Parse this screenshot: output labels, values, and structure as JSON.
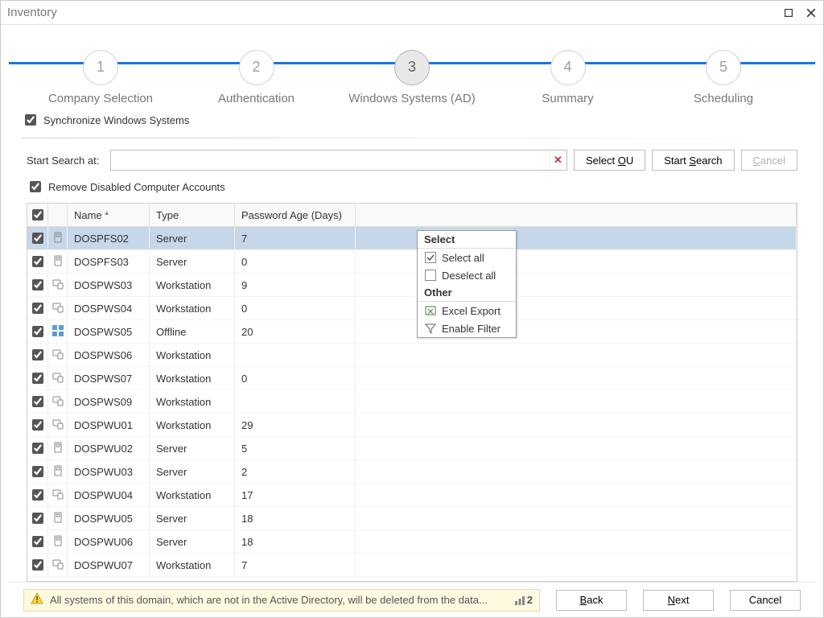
{
  "window": {
    "title": "Inventory"
  },
  "wizard": {
    "steps": [
      {
        "num": "1",
        "label": "Company Selection"
      },
      {
        "num": "2",
        "label": "Authentication"
      },
      {
        "num": "3",
        "label": "Windows Systems (AD)"
      },
      {
        "num": "4",
        "label": "Summary"
      },
      {
        "num": "5",
        "label": "Scheduling"
      }
    ],
    "active_index": 2
  },
  "sync_label": "Synchronize Windows Systems",
  "search": {
    "label": "Start Search at:",
    "value": "",
    "select_ou_pre": "Select ",
    "select_ou_u": "O",
    "select_ou_post": "U",
    "start_search_pre": "Start ",
    "start_search_u": "S",
    "start_search_post": "earch",
    "cancel_u": "C",
    "cancel_post": "ancel"
  },
  "remove_label": "Remove Disabled Computer Accounts",
  "table": {
    "columns": {
      "name": "Name",
      "type": "Type",
      "pwd": "Password Age (Days)"
    },
    "rows": [
      {
        "name": "DOSPFS02",
        "type": "Server",
        "pwd": "7",
        "icon": "server",
        "sel": true
      },
      {
        "name": "DOSPFS03",
        "type": "Server",
        "pwd": "0",
        "icon": "server"
      },
      {
        "name": "DOSPWS03",
        "type": "Workstation",
        "pwd": "9",
        "icon": "ws"
      },
      {
        "name": "DOSPWS04",
        "type": "Workstation",
        "pwd": "0",
        "icon": "ws"
      },
      {
        "name": "DOSPWS05",
        "type": "Offline",
        "pwd": "20",
        "icon": "offline"
      },
      {
        "name": "DOSPWS06",
        "type": "Workstation",
        "pwd": "",
        "icon": "ws"
      },
      {
        "name": "DOSPWS07",
        "type": "Workstation",
        "pwd": "0",
        "icon": "ws"
      },
      {
        "name": "DOSPWS09",
        "type": "Workstation",
        "pwd": "",
        "icon": "ws"
      },
      {
        "name": "DOSPWU01",
        "type": "Workstation",
        "pwd": "29",
        "icon": "ws"
      },
      {
        "name": "DOSPWU02",
        "type": "Server",
        "pwd": "5",
        "icon": "server"
      },
      {
        "name": "DOSPWU03",
        "type": "Server",
        "pwd": "2",
        "icon": "server"
      },
      {
        "name": "DOSPWU04",
        "type": "Workstation",
        "pwd": "17",
        "icon": "ws"
      },
      {
        "name": "DOSPWU05",
        "type": "Server",
        "pwd": "18",
        "icon": "server"
      },
      {
        "name": "DOSPWU06",
        "type": "Server",
        "pwd": "18",
        "icon": "server"
      },
      {
        "name": "DOSPWU07",
        "type": "Workstation",
        "pwd": "7",
        "icon": "ws"
      }
    ]
  },
  "context_menu": {
    "select": "Select",
    "select_all": "Select all",
    "deselect_all": "Deselect all",
    "other": "Other",
    "excel": "Excel Export",
    "filter": "Enable Filter"
  },
  "warning": {
    "text": "All systems of this domain, which are not in the Active Directory, will be deleted from the data...",
    "count": "2"
  },
  "footer": {
    "back_u": "B",
    "back_post": "ack",
    "next_u": "N",
    "next_post": "ext",
    "cancel": "Cancel"
  }
}
